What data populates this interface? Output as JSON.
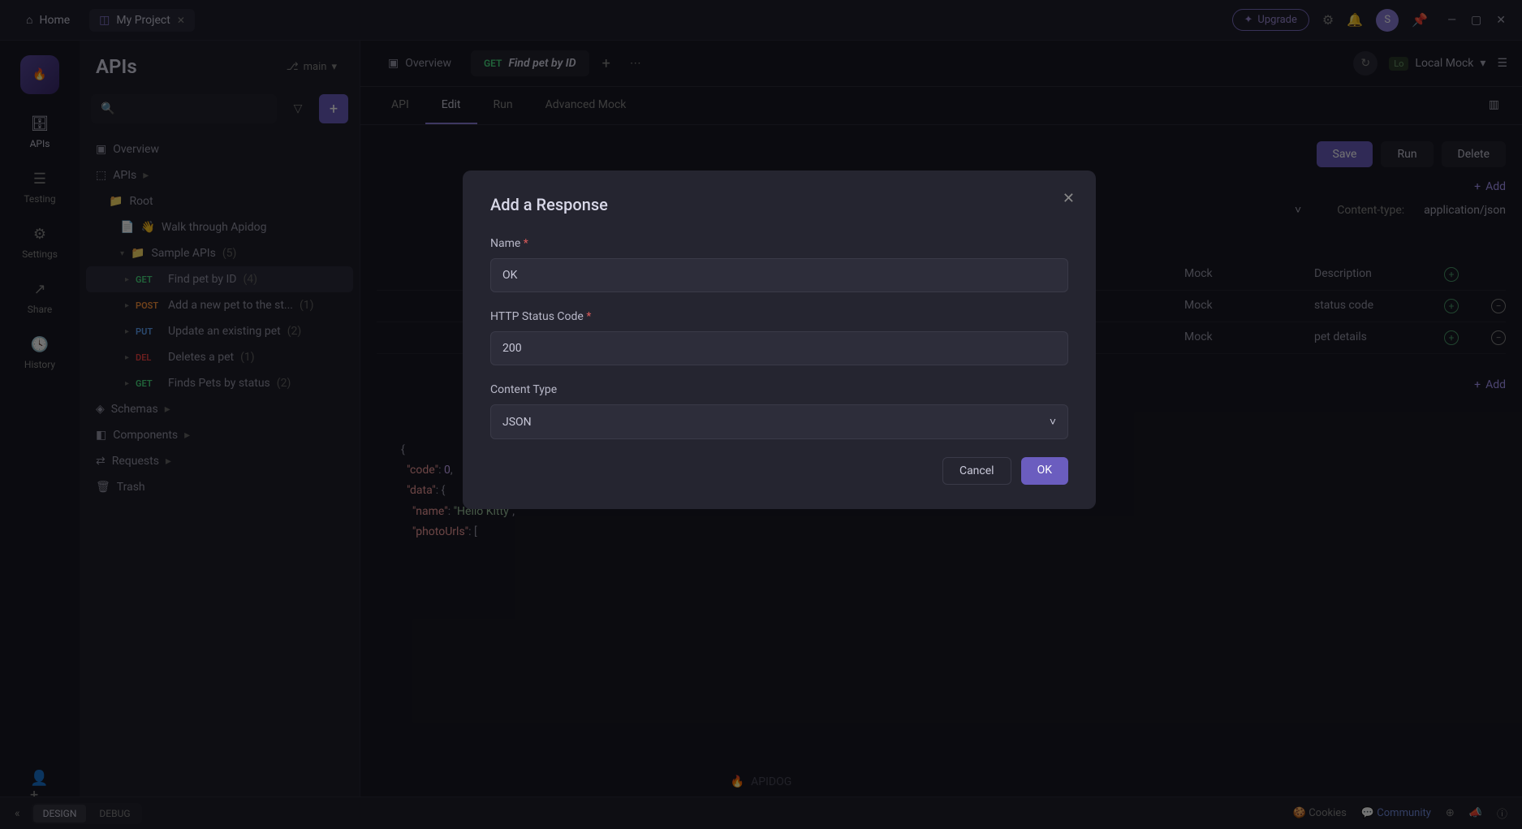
{
  "titlebar": {
    "home": "Home",
    "project_tab": "My Project",
    "upgrade": "Upgrade",
    "avatar_letter": "S"
  },
  "rail": {
    "apis": "APIs",
    "testing": "Testing",
    "settings": "Settings",
    "share": "Share",
    "history": "History",
    "invite": "Invite"
  },
  "sidebar": {
    "title": "APIs",
    "branch": "main",
    "overview": "Overview",
    "apis_node": "APIs",
    "root": "Root",
    "walkthrough": "Walk through Apidog",
    "sample_apis": "Sample APIs",
    "sample_apis_count": "(5)",
    "endpoints": [
      {
        "method": "GET",
        "label": "Find pet by ID",
        "count": "(4)"
      },
      {
        "method": "POST",
        "label": "Add a new pet to the st...",
        "count": "(1)"
      },
      {
        "method": "PUT",
        "label": "Update an existing pet",
        "count": "(2)"
      },
      {
        "method": "DEL",
        "label": "Deletes a pet",
        "count": "(1)"
      },
      {
        "method": "GET",
        "label": "Finds Pets by status",
        "count": "(2)"
      }
    ],
    "schemas": "Schemas",
    "components": "Components",
    "requests": "Requests",
    "trash": "Trash",
    "brand": "APIDOG"
  },
  "content_tabs": {
    "overview": "Overview",
    "active_method": "GET",
    "active_label": "Find pet by ID"
  },
  "env": {
    "label": "Local Mock"
  },
  "subtabs": {
    "api": "API",
    "edit": "Edit",
    "run": "Run",
    "adv": "Advanced Mock"
  },
  "actions": {
    "save": "Save",
    "run": "Run",
    "delete": "Delete",
    "add": "Add"
  },
  "info": {
    "ct_label": "Content-type:",
    "ct_value": "application/json"
  },
  "params": {
    "col_mock": "Mock",
    "col_desc": "Description",
    "rows": [
      {
        "mock": "Mock",
        "desc": ""
      },
      {
        "mock": "Mock",
        "desc": "status code"
      },
      {
        "mock": "Mock",
        "desc": "pet details"
      }
    ]
  },
  "code": {
    "l1": "{",
    "l2_k": "\"code\"",
    "l2_v": "0",
    "l3_k": "\"data\"",
    "l4_k": "\"name\"",
    "l4_v": "\"Hello Kitty\"",
    "l5_k": "\"photoUrls\""
  },
  "footer": {
    "design": "DESIGN",
    "debug": "DEBUG",
    "cookies": "Cookies",
    "community": "Community"
  },
  "modal": {
    "title": "Add a Response",
    "name_label": "Name",
    "name_value": "OK",
    "code_label": "HTTP Status Code",
    "code_value": "200",
    "ct_label": "Content Type",
    "ct_value": "JSON",
    "cancel": "Cancel",
    "ok": "OK"
  }
}
